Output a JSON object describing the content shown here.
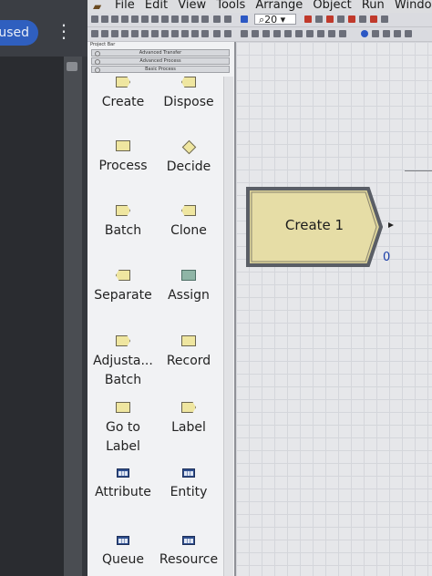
{
  "left_app": {
    "status_pill": "used",
    "menu_glyph": "⋮"
  },
  "menubar": {
    "items": [
      "File",
      "Edit",
      "View",
      "Tools",
      "Arrange",
      "Object",
      "Run",
      "Window"
    ]
  },
  "toolbar": {
    "zoom_value": "20"
  },
  "project_bar": {
    "title": "Project Bar",
    "panels": [
      "Advanced Transfer",
      "Advanced Process",
      "Basic Process"
    ],
    "modules": [
      {
        "label": "Create",
        "icon": "create-module-icon"
      },
      {
        "label": "Dispose",
        "icon": "dispose-module-icon"
      },
      {
        "label": "Process",
        "icon": "process-module-icon"
      },
      {
        "label": "Decide",
        "icon": "decide-module-icon"
      },
      {
        "label": "Batch",
        "icon": "batch-module-icon"
      },
      {
        "label": "Clone",
        "icon": "clone-module-icon"
      },
      {
        "label": "Separate",
        "icon": "separate-module-icon"
      },
      {
        "label": "Assign",
        "icon": "assign-module-icon"
      },
      {
        "label": "Adjusta... Batch",
        "icon": "adjustable-batch-module-icon"
      },
      {
        "label": "Record",
        "icon": "record-module-icon"
      },
      {
        "label": "Go to Label",
        "icon": "goto-label-module-icon"
      },
      {
        "label": "Label",
        "icon": "label-module-icon"
      },
      {
        "label": "Attribute",
        "icon": "attribute-spreadsheet-icon"
      },
      {
        "label": "Entity",
        "icon": "entity-spreadsheet-icon"
      },
      {
        "label": "Queue",
        "icon": "queue-spreadsheet-icon"
      },
      {
        "label": "Resource",
        "icon": "resource-spreadsheet-icon"
      }
    ]
  },
  "canvas": {
    "block_label": "Create 1",
    "block_counter": "0"
  },
  "colors": {
    "module_fill": "#efe6a0",
    "assign_fill": "#8fb5a6",
    "spreadsheet_fill": "#2f4f8f",
    "pill_blue": "#2f5fbf",
    "counter_blue": "#1c3fa8"
  }
}
